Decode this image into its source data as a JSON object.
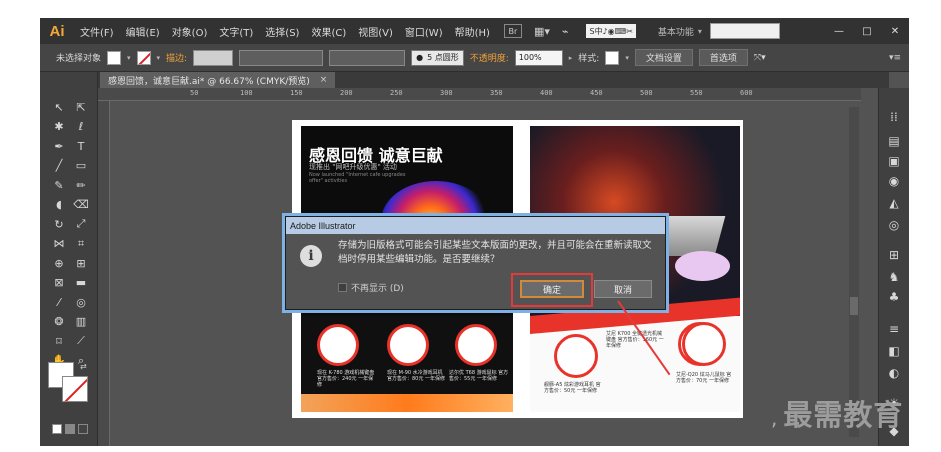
{
  "app": {
    "logo": "Ai",
    "menu": [
      "文件(F)",
      "编辑(E)",
      "对象(O)",
      "文字(T)",
      "选择(S)",
      "效果(C)",
      "视图(V)",
      "窗口(W)",
      "帮助(H)"
    ],
    "bridge_label": "Br",
    "ime_text": "S中♪◉⌨✂",
    "workspace_label": "基本功能",
    "window_controls": [
      "—",
      "□",
      "✕"
    ]
  },
  "control_bar": {
    "selection_label": "未选择对象",
    "stroke_label": "描边:",
    "brush_value": "5 点圆形",
    "opacity_label": "不透明度:",
    "opacity_value": "100%",
    "style_label": "样式:",
    "doc_setup_button": "文档设置",
    "preferences_button": "首选项"
  },
  "document_tab": {
    "title": "感恩回馈，诚意巨献.ai* @ 66.67% (CMYK/预览)",
    "close": "×"
  },
  "ruler_numbers": [
    "50",
    "100",
    "150",
    "200",
    "250",
    "300",
    "350",
    "400",
    "450",
    "500",
    "550",
    "600"
  ],
  "artwork": {
    "headline": "感恩回馈 诚意巨献",
    "subline": "现推出 \"网吧升级优惠\" 活动",
    "english": "Now launched \"Internet cafe upgrades offer\" activities",
    "left_products": [
      {
        "text": "现在 K-780 游戏机械键盘 官方售价：240元 一年保修"
      },
      {
        "text": "现在 M-90 水冷游戏耳机 官方售价：80元 一年保修"
      },
      {
        "text": "达尔优 T68 游戏鼠标 官方售价：55元 一年保修"
      }
    ],
    "right_products": [
      {
        "text": "艾尼 K700 全键透光机械键盘 官方售价：160元 一年保修"
      },
      {
        "text": "舰豚-A5 炫彩游戏耳机 官方售价：50元 一年保修"
      },
      {
        "text": "艾尼-Q20 炫马儿鼠标 官方售价：70元 一年保修"
      }
    ]
  },
  "dialog": {
    "title": "Adobe Illustrator",
    "message": "存储为旧版格式可能会引起某些文本版面的更改，并且可能会在重新读取文档时停用某些编辑功能。是否要继续？",
    "dont_show_label": "不再显示 (D)",
    "ok_label": "确定",
    "cancel_label": "取消"
  },
  "watermark": {
    "dot": ",",
    "text": "最需教育"
  },
  "icons": {
    "info": "i"
  }
}
